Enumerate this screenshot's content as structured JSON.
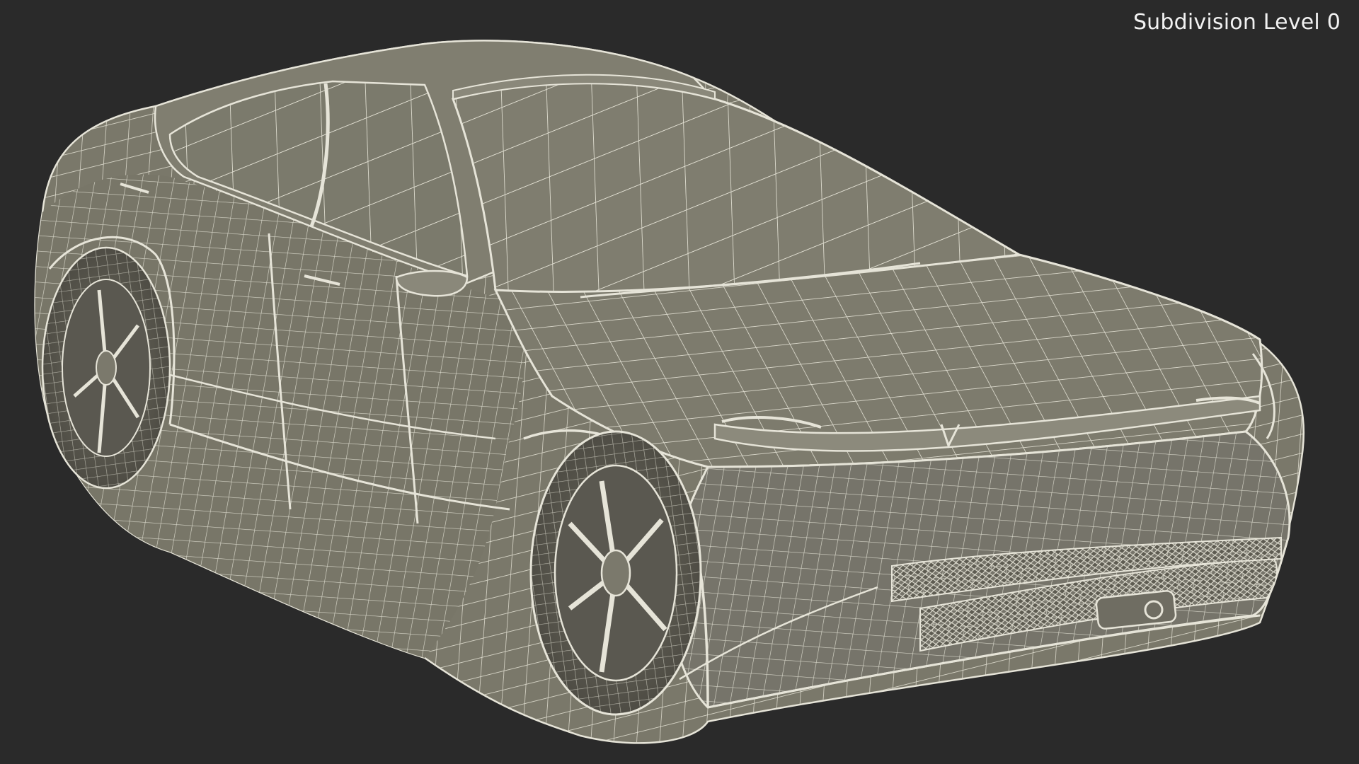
{
  "viewport": {
    "overlay_label": "Subdivision Level 0",
    "background_color": "#2a2a2a",
    "model": {
      "render_style": "wireframe-on-shaded",
      "surface_color": "#7d7b6c",
      "wire_color": "#e6e4d8",
      "dark_color": "#4a4a42"
    }
  }
}
